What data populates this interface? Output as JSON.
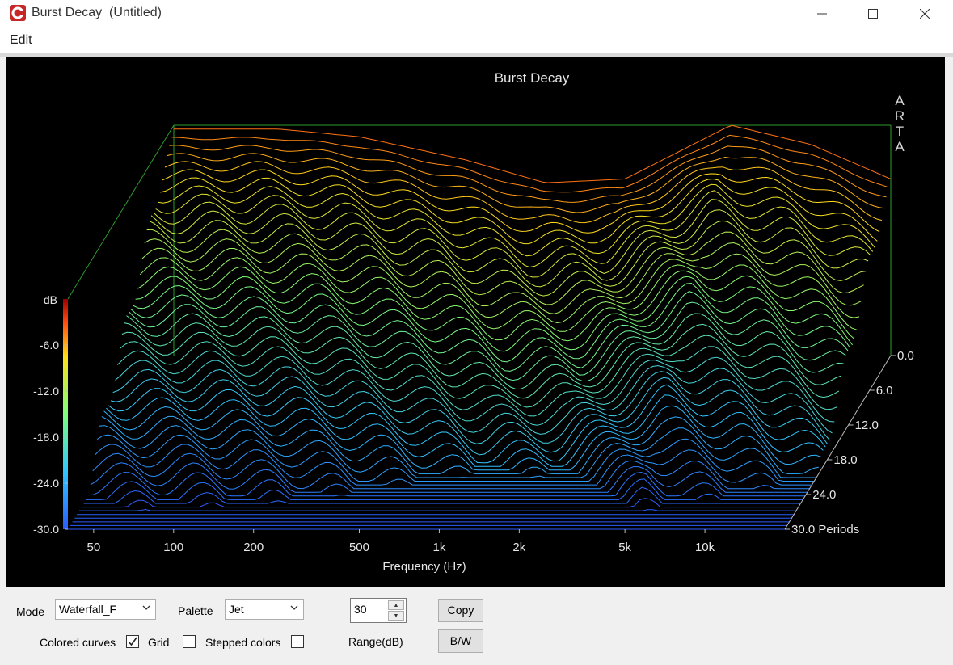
{
  "window": {
    "app_name": "Burst Decay",
    "doc_name": "(Untitled)",
    "icon": "arta-app-icon",
    "controls": [
      "minimize-icon",
      "maximize-icon",
      "close-icon"
    ]
  },
  "menu": {
    "items": [
      "Edit"
    ]
  },
  "chart_data": {
    "type": "waterfall",
    "title": "Burst Decay",
    "watermark": "ARTA",
    "xlabel": "Frequency (Hz)",
    "x_scale": "log",
    "x_ticks": [
      "50",
      "100",
      "200",
      "500",
      "1k",
      "2k",
      "5k",
      "10k"
    ],
    "xlim": [
      40,
      20000
    ],
    "z_label": "dB",
    "z_ticks": [
      "-6.0",
      "-12.0",
      "-18.0",
      "-24.0",
      "-30.0"
    ],
    "z_range": [
      -30,
      0
    ],
    "depth_ticks": [
      "0.0",
      "6.0",
      "12.0",
      "18.0",
      "24.0",
      "30.0 Periods"
    ],
    "depth_range_periods": [
      0,
      30
    ],
    "palette": "Jet",
    "initial_response_db": {
      "frequencies": [
        "100",
        "200",
        "500",
        "1k",
        "2k",
        "5k",
        "10k",
        "20k"
      ],
      "values": [
        -0.5,
        -1.5,
        -4.5,
        -7.5,
        -7.0,
        0.0,
        -2.5,
        -7.0
      ]
    }
  },
  "controls": {
    "mode_label": "Mode",
    "mode_value": "Waterfall_F",
    "palette_label": "Palette",
    "palette_value": "Jet",
    "range_value": "30",
    "range_label": "Range(dB)",
    "copy_label": "Copy",
    "bw_label": "B/W",
    "colored_curves_label": "Colored curves",
    "colored_curves_checked": true,
    "grid_label": "Grid",
    "grid_checked": false,
    "stepped_colors_label": "Stepped colors",
    "stepped_colors_checked": false
  }
}
